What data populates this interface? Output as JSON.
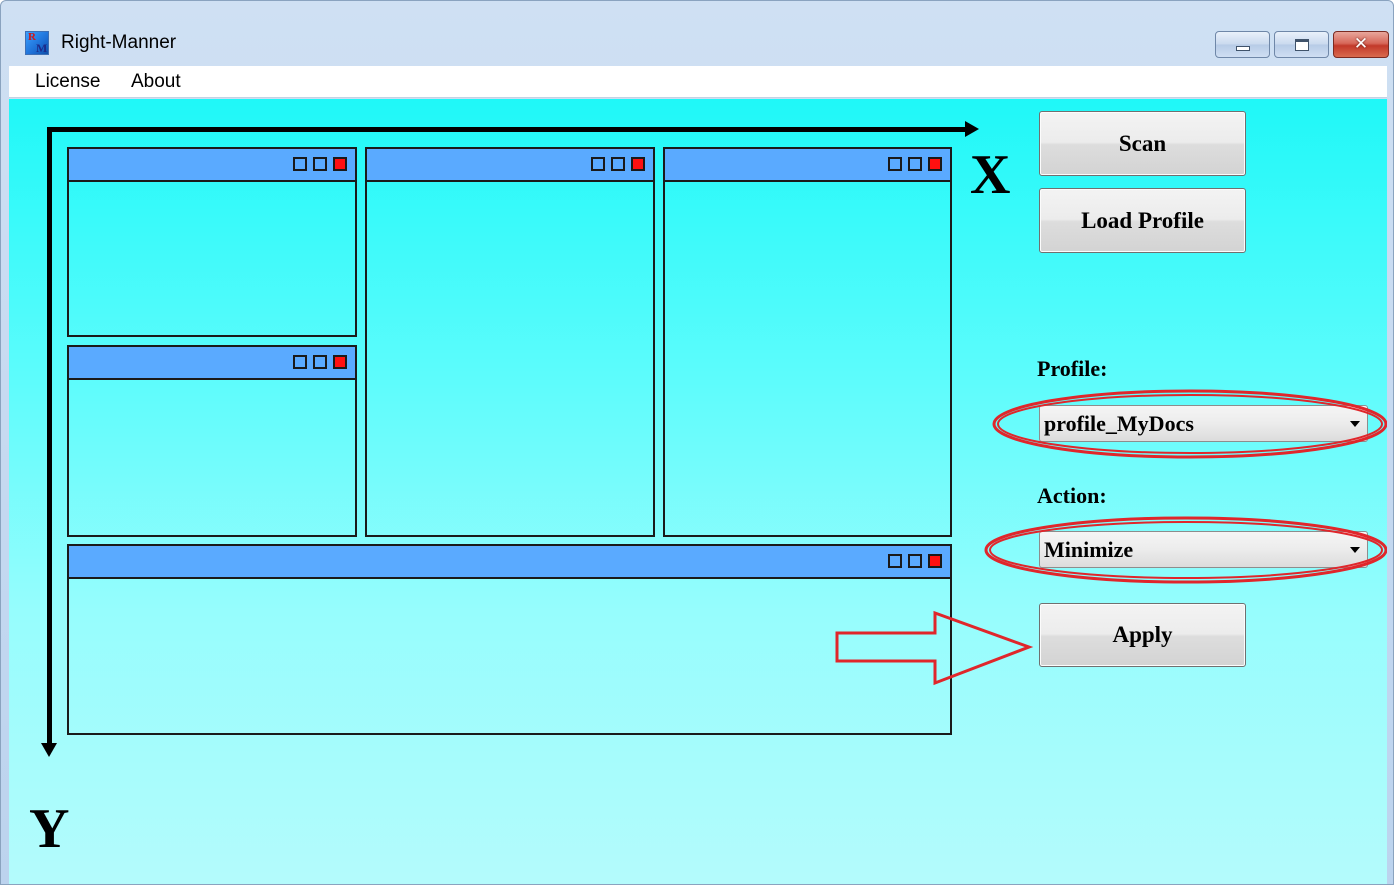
{
  "window": {
    "title": "Right-Manner",
    "icon_letters": [
      "R",
      "M"
    ]
  },
  "menu": {
    "items": [
      "License",
      "About"
    ]
  },
  "diagram": {
    "x_label": "X",
    "y_label": "Y"
  },
  "buttons": {
    "scan": "Scan",
    "load_profile": "Load Profile",
    "apply": "Apply"
  },
  "profile": {
    "label": "Profile:",
    "value": "profile_MyDocs"
  },
  "action": {
    "label": "Action:",
    "value": "Minimize"
  },
  "colors": {
    "client_top": "#1ff8f8",
    "client_bottom": "#b4fbfc",
    "pane_titlebar": "#5aaaff",
    "pane_close": "#ff1010",
    "annotation": "#e0262b"
  },
  "icons": [
    "minimize-icon",
    "maximize-icon",
    "close-icon",
    "dropdown-arrow-icon",
    "pointer-arrow-icon"
  ]
}
